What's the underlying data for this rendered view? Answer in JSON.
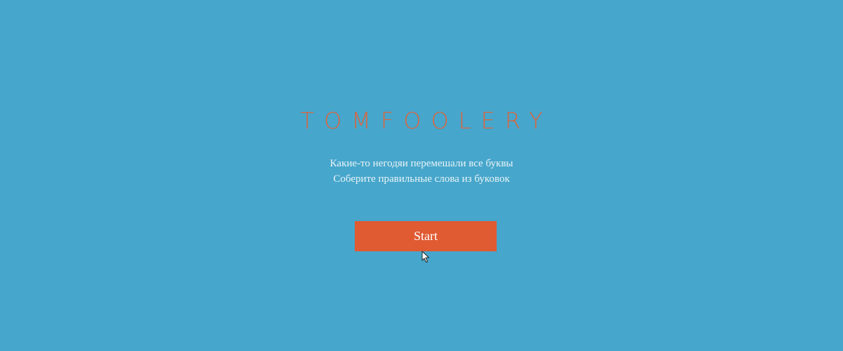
{
  "game": {
    "title": "TOMFOOLERY",
    "description": [
      "Какие-то негодяи перемешали все буквы",
      "Соберите правильные слова из буковок"
    ],
    "start_label": "Start"
  },
  "colors": {
    "background": "#47a6cb",
    "title": "#d9663f",
    "button": "#e05a32",
    "text": "#e8f4f8"
  },
  "icons": {
    "pointer": "mouse-pointer-icon"
  }
}
